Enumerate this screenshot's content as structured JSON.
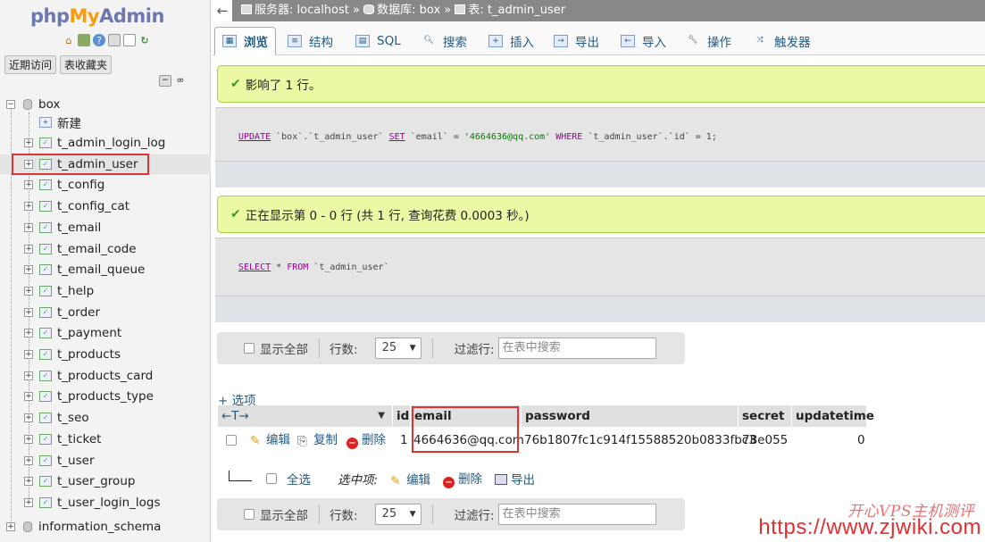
{
  "logo": {
    "php": "php",
    "my": "My",
    "admin": "Admin"
  },
  "nav": {
    "recent": "近期访问",
    "favorites": "表收藏夹",
    "db_name": "box",
    "new_label": "新建",
    "tables": [
      "t_admin_login_log",
      "t_admin_user",
      "t_config",
      "t_config_cat",
      "t_email",
      "t_email_code",
      "t_email_queue",
      "t_help",
      "t_order",
      "t_payment",
      "t_products",
      "t_products_card",
      "t_products_type",
      "t_seo",
      "t_ticket",
      "t_user",
      "t_user_group",
      "t_user_login_logs"
    ],
    "other_db": "information_schema"
  },
  "breadcrumb": {
    "server": "服务器: localhost",
    "sep1": "»",
    "database": "数据库: box",
    "sep2": "»",
    "table": "表: t_admin_user"
  },
  "tabs": [
    "浏览",
    "结构",
    "SQL",
    "搜索",
    "插入",
    "导出",
    "导入",
    "操作",
    "触发器"
  ],
  "messages": {
    "affected": "影响了 1 行。",
    "showing": "正在显示第 0 - 0 行 (共 1 行, 查询花费 0.0003 秒。)"
  },
  "sql": {
    "update": {
      "kw1": "UPDATE",
      "table": " `box`.`t_admin_user` ",
      "kw2": "SET",
      "col": " `email` = ",
      "value": "'4664636@qq.com'",
      "kw3": " WHERE ",
      "cond": "`t_admin_user`.`id` = 1;"
    },
    "select": {
      "kw1": "SELECT",
      "star": " * ",
      "kw2": "FROM",
      "table": " `t_admin_user`"
    }
  },
  "navbar": {
    "show_all": "显示全部",
    "rows_label": "行数:",
    "rows_value": "25",
    "filter_label": "过滤行:",
    "filter_placeholder": "在表中搜索"
  },
  "options_link": "+ 选项",
  "table": {
    "sort_arrows": "←T→",
    "columns": [
      "id",
      "email",
      "password",
      "secret",
      "updatetime"
    ],
    "row": {
      "edit": "编辑",
      "copy": "复制",
      "delete": "删除",
      "id": "1",
      "email": "4664636@qq.com",
      "password": "76b1807fc1c914f15588520b0833fbc3",
      "secret": "78e055",
      "updatetime": "0"
    }
  },
  "bulk": {
    "select_all": "全选",
    "with_selected": "选中项:",
    "edit": "编辑",
    "delete": "删除",
    "export": "导出"
  },
  "watermark": {
    "url": "https://www.zjwiki.com",
    "cn": "开心VPS主机测评"
  }
}
